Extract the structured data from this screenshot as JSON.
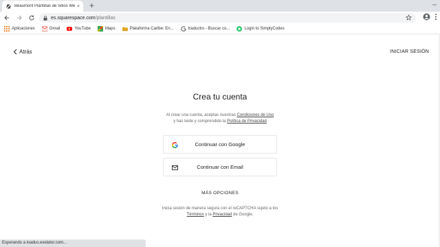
{
  "browser": {
    "tab_title": "Beaumont Plantillas de Sitios Web ·",
    "tab_close": "×",
    "new_tab": "+",
    "url_domain": "es.squarespace.com",
    "url_path": "/plantillas",
    "status_text": "Esperando a loadus.exelator.com..."
  },
  "bookmarks": [
    {
      "label": "Aplicaciones",
      "icon": "apps-grid-icon"
    },
    {
      "label": "Gmail",
      "icon": "gmail-icon"
    },
    {
      "label": "YouTube",
      "icon": "youtube-icon"
    },
    {
      "label": "Maps",
      "icon": "maps-icon"
    },
    {
      "label": "Plataforma Caribe: En...",
      "icon": "folder-icon"
    },
    {
      "label": "traductro - Buscar co...",
      "icon": "google-icon"
    },
    {
      "label": "Login to SimplyCodes",
      "icon": "simplycodes-icon"
    }
  ],
  "page": {
    "back_label": "Atrás",
    "login_label": "INICIAR SESIÓN",
    "heading": "Crea tu cuenta",
    "terms_prefix": "Al crear una cuenta, aceptas nuestras",
    "terms_link": "Condiciones de Uso",
    "terms_middle": "y has leído y comprendido la",
    "privacy_link": "Política de Privacidad",
    "google_button": "Continuar con Google",
    "email_button": "Continuar con Email",
    "more_options": "MÁS OPCIONES",
    "recaptcha_prefix": "Inicia sesión de manera segura con el reCAPTCHA sujeto a los",
    "recaptcha_terms": "Términos",
    "recaptcha_and": "y la",
    "recaptcha_privacy": "Privacidad",
    "recaptcha_suffix": "de Google."
  },
  "colors": {
    "tabstrip": "#dee1e6",
    "omnibox": "#f1f3f4",
    "google_blue": "#4285f4",
    "google_red": "#ea4335",
    "google_yellow": "#fbbc05",
    "google_green": "#34a853"
  }
}
